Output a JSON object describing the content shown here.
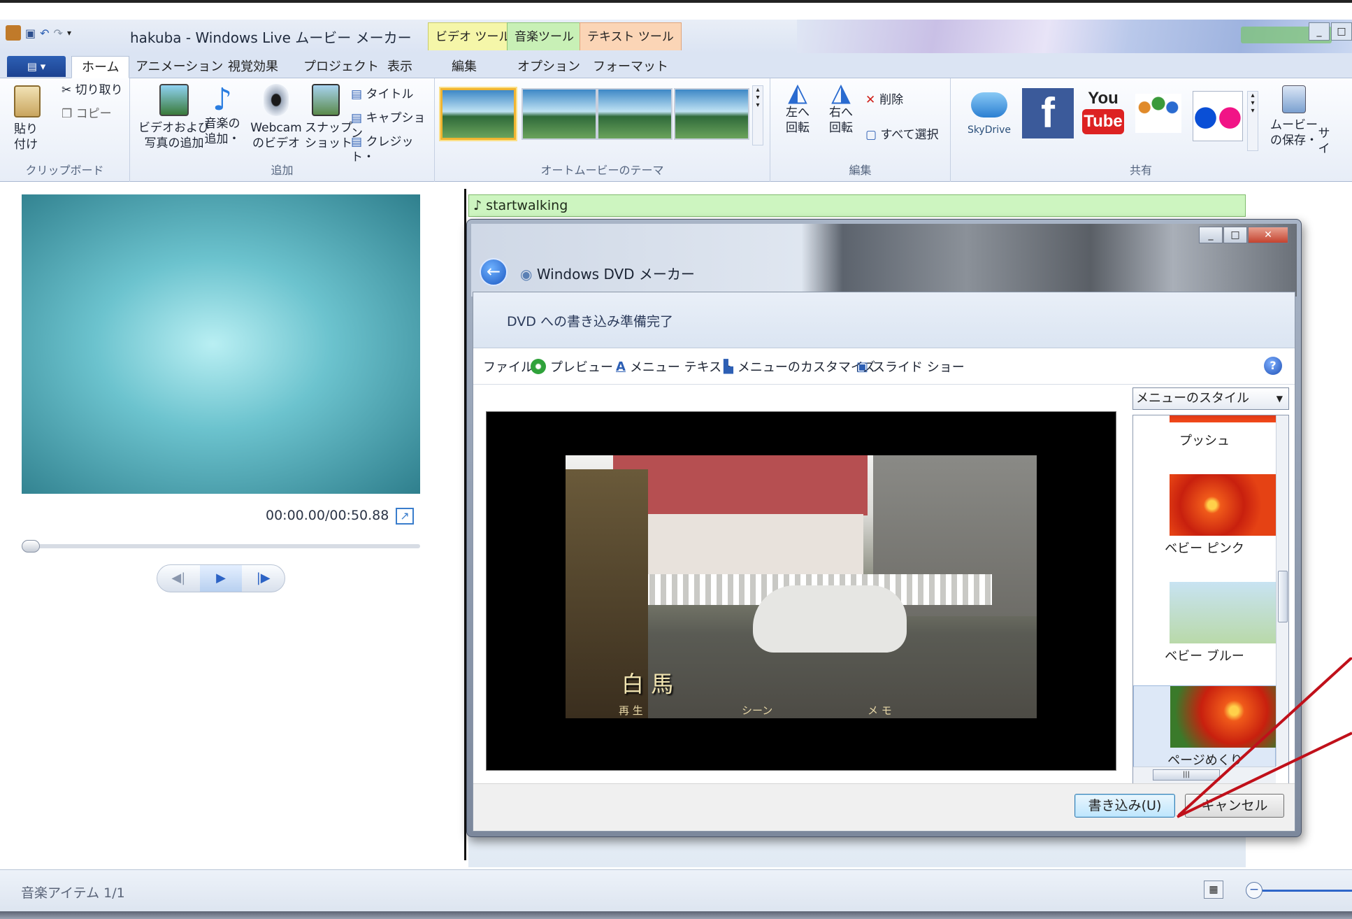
{
  "app": {
    "title": "hakuba - Windows Live ムービー メーカー",
    "context_tabs": [
      "ビデオ ツール",
      "音楽ツール",
      "テキスト ツール"
    ]
  },
  "tabs": [
    "ホーム",
    "アニメーション",
    "視覚効果",
    "プロジェクト",
    "表示",
    "編集",
    "オプション",
    "フォーマット"
  ],
  "ribbon": {
    "clipboard": {
      "paste": "貼り\n付け",
      "cut": "切り取り",
      "copy": "コピー",
      "label": "クリップボード"
    },
    "add": {
      "add_video": "ビデオおよび\n写真の追加",
      "add_music": "音楽の\n追加・",
      "webcam": "Webcam\nのビデオ",
      "snapshot": "スナップ\nショット",
      "title": "タイトル",
      "caption": "キャプション",
      "credit": "クレジット・",
      "label": "追加"
    },
    "themes": {
      "label": "オートムービーのテーマ"
    },
    "edit": {
      "rotate_left": "左へ\n回転",
      "rotate_right": "右へ\n回転",
      "delete": "削除",
      "select_all": "すべて選択",
      "label": "編集"
    },
    "share": {
      "skydrive": "SkyDrive",
      "youtube_top": "You",
      "youtube_bottom": "Tube",
      "save_movie": "ムービー\nの保存・",
      "sign": "サイ",
      "label": "共有"
    }
  },
  "player": {
    "timecode": "00:00.00/00:50.88",
    "progress": 0
  },
  "storyboard": {
    "music_track": "♪ startwalking"
  },
  "status": {
    "text": "音楽アイテム 1/1"
  },
  "dvd": {
    "window_title": "Windows DVD メーカー",
    "heading": "DVD への書き込み準備完了",
    "toolbar": [
      "ファイル",
      "プレビュー",
      "メニュー テキスト",
      "メニューのカスタマイズ",
      "スライド ショー"
    ],
    "video": {
      "caption": "白 馬",
      "menu": [
        "再 生",
        "シーン",
        "メ モ"
      ]
    },
    "style_select": "メニューのスタイル",
    "styles": [
      "プッシュ",
      "ベビー ピンク",
      "ベビー ブルー",
      "ページめくり"
    ],
    "buttons": {
      "burn": "書き込み(U)",
      "cancel": "キャンセル"
    }
  },
  "colors": {
    "accent": "#2d5fb4",
    "music_track": "#cdf5c0",
    "selected_theme": "#f0b430",
    "annotation_arrow": "#c0101a"
  }
}
